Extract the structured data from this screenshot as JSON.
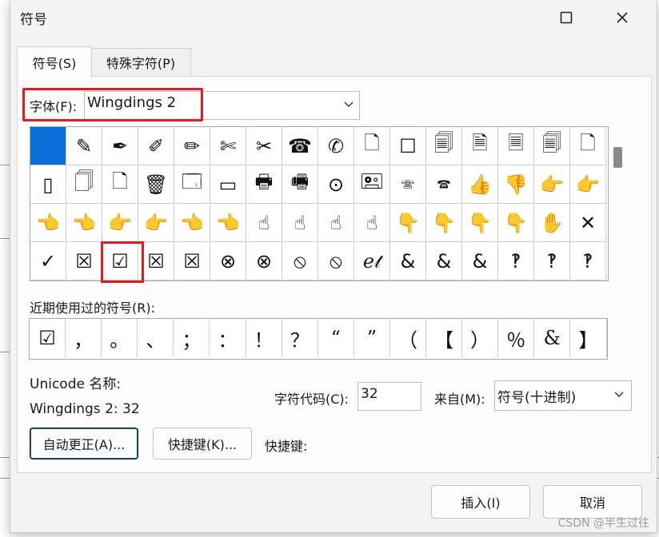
{
  "window": {
    "title": "符号"
  },
  "tabs": [
    {
      "label": "符号(S)"
    },
    {
      "label": "特殊字符(P)"
    }
  ],
  "font": {
    "label": "字体(F):",
    "value": "Wingdings 2"
  },
  "symbol_grid": {
    "rows": [
      [
        "",
        "✎",
        "✒",
        "✐",
        "✏",
        "✄",
        "✂",
        "☎",
        "✆",
        "🗋",
        "☐",
        "🗐",
        "🗎",
        "🗏",
        "🗐",
        "🗋"
      ],
      [
        "▯",
        "🗍",
        "🗋",
        "🗑",
        "🗔",
        "▭",
        "🖶",
        "🖷",
        "⊙",
        "🖭",
        "🕾",
        "🕿",
        "👍",
        "👎",
        "👉",
        "👉"
      ],
      [
        "👈",
        "👈",
        "👉",
        "👉",
        "👈",
        "👈",
        "☝",
        "☝",
        "☝",
        "☝",
        "👇",
        "👇",
        "👇",
        "👇",
        "✋",
        "✕"
      ],
      [
        "✓",
        "☒",
        "☑",
        "☒",
        "☒",
        "⊗",
        "⊗",
        "⦸",
        "⦸",
        "ℯ𝓉",
        "&",
        "&",
        "&",
        "‽",
        "‽",
        "‽"
      ]
    ],
    "selected_index": 0,
    "highlighted_symbol": "☑"
  },
  "recent": {
    "label": "近期使用过的符号(R):",
    "symbols": [
      "☑",
      "，",
      "。",
      "、",
      "；",
      "：",
      "！",
      "？",
      "“",
      "”",
      "（",
      "【",
      "）",
      "％",
      "&",
      "】"
    ]
  },
  "unicode": {
    "label": "Unicode 名称:",
    "value": "Wingdings 2: 32"
  },
  "char_code": {
    "label": "字符代码(C):",
    "value": "32"
  },
  "from": {
    "label": "来自(M):",
    "value": "符号(十进制)"
  },
  "buttons": {
    "autocorrect": "自动更正(A)...",
    "shortcut_key": "快捷键(K)...",
    "insert": "插入(I)",
    "cancel": "取消"
  },
  "shortcut_label": "快捷键:",
  "watermark": "CSDN @半生过往",
  "colors": {
    "accent": "#0a6fd8",
    "highlight": "#e8191f"
  }
}
